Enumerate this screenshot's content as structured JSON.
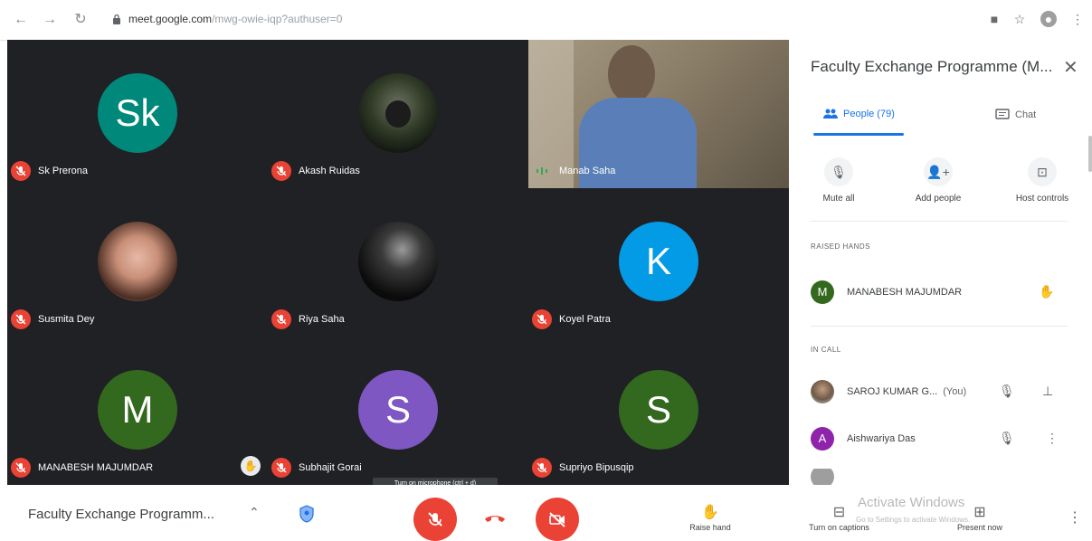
{
  "browser": {
    "url_host": "meet.google.com",
    "url_path": "/mwg-owie-iqp?authuser=0",
    "icons": [
      "back-icon",
      "forward-icon",
      "reload-icon",
      "lock-icon",
      "camera-icon",
      "star-icon",
      "profile-icon",
      "menu-icon"
    ]
  },
  "tiles": [
    {
      "name": "Sk Prerona",
      "initials": "Sk",
      "color": "#00897b",
      "muted": true
    },
    {
      "name": "Akash Ruidas",
      "photo": true,
      "muted": true
    },
    {
      "name": "Manab Saha",
      "video": true,
      "speaking": true
    },
    {
      "name": "Susmita Dey",
      "photo": true,
      "muted": true
    },
    {
      "name": "Riya Saha",
      "photo": true,
      "muted": true
    },
    {
      "name": "Koyel Patra",
      "initials": "K",
      "color": "#039be5",
      "muted": true
    },
    {
      "name": "MANABESH MAJUMDAR",
      "initials": "M",
      "color": "#33691e",
      "muted": true
    },
    {
      "name": "Subhajit Gorai",
      "initials": "S",
      "color": "#7e57c2",
      "muted": true
    },
    {
      "name": "Supriyo Bipusqip",
      "initials": "S",
      "color": "#33691e",
      "muted": true
    }
  ],
  "tooltip": "Turn on microphone (ctrl + d)",
  "panel": {
    "title": "Faculty Exchange Programme (M...",
    "tabs": {
      "people": "People (79)",
      "chat": "Chat"
    },
    "actions": {
      "mute_all": "Mute all",
      "add_people": "Add people",
      "host_controls": "Host controls"
    },
    "raised_hands_label": "RAISED HANDS",
    "raised": {
      "name": "MANABESH MAJUMDAR",
      "initial": "M",
      "color": "#33691e"
    },
    "in_call_label": "IN CALL",
    "participants": [
      {
        "name": "SAROJ KUMAR G...",
        "you": "(You)"
      },
      {
        "name": "Aishwariya Das",
        "initial": "A",
        "color": "#8e24aa"
      }
    ]
  },
  "bottom": {
    "meeting_title": "Faculty Exchange Programm...",
    "raise_hand": "Raise hand",
    "captions": "Turn on captions",
    "present": "Present now"
  },
  "watermark": {
    "title": "Activate Windows",
    "sub": "Go to Settings to activate Windows."
  },
  "colors": {
    "accent": "#1a73e8",
    "danger": "#ea4335",
    "grid_bg": "#202124"
  }
}
